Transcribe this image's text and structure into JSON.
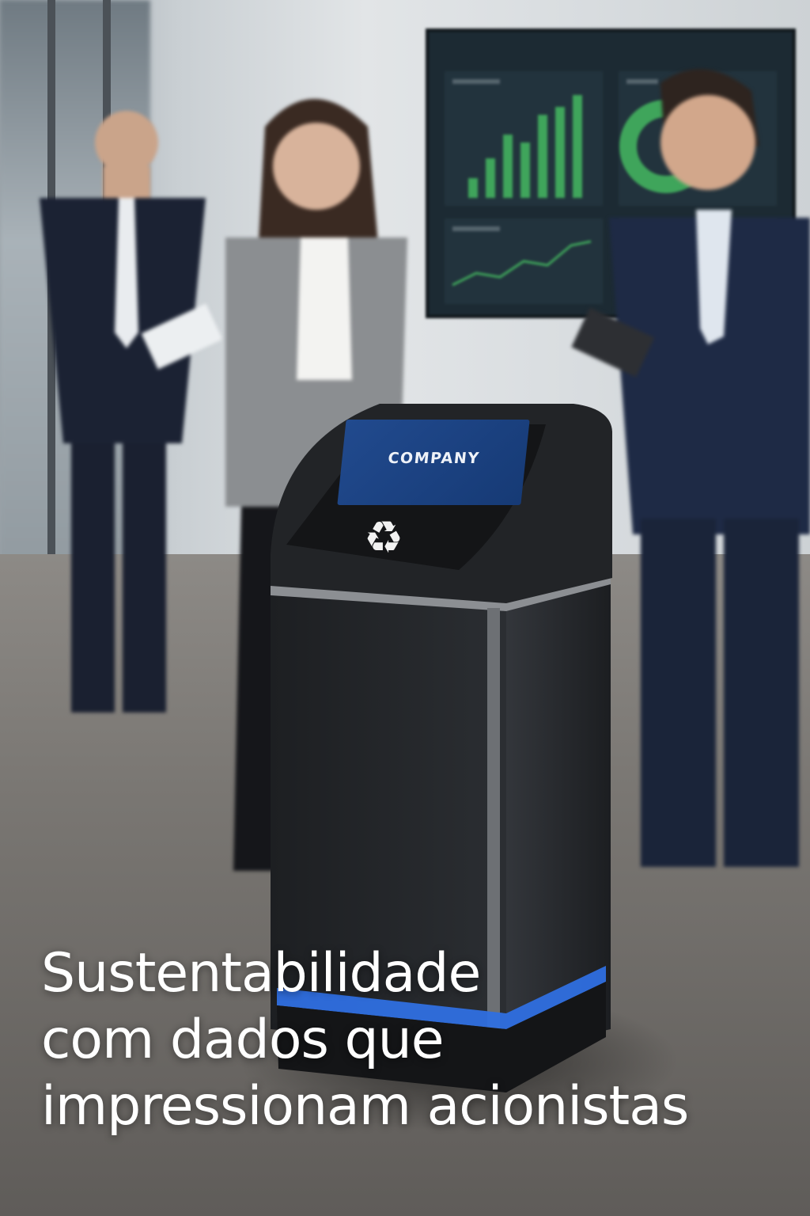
{
  "product": {
    "screen_label": "COMPANY",
    "icon": "recycle-icon",
    "accent_color": "#2f6fe0",
    "screen_color": "#1e4688"
  },
  "headline": {
    "line1": "Sustentabilidade",
    "line2": "com dados que",
    "line3": "impressionam acionistas"
  }
}
